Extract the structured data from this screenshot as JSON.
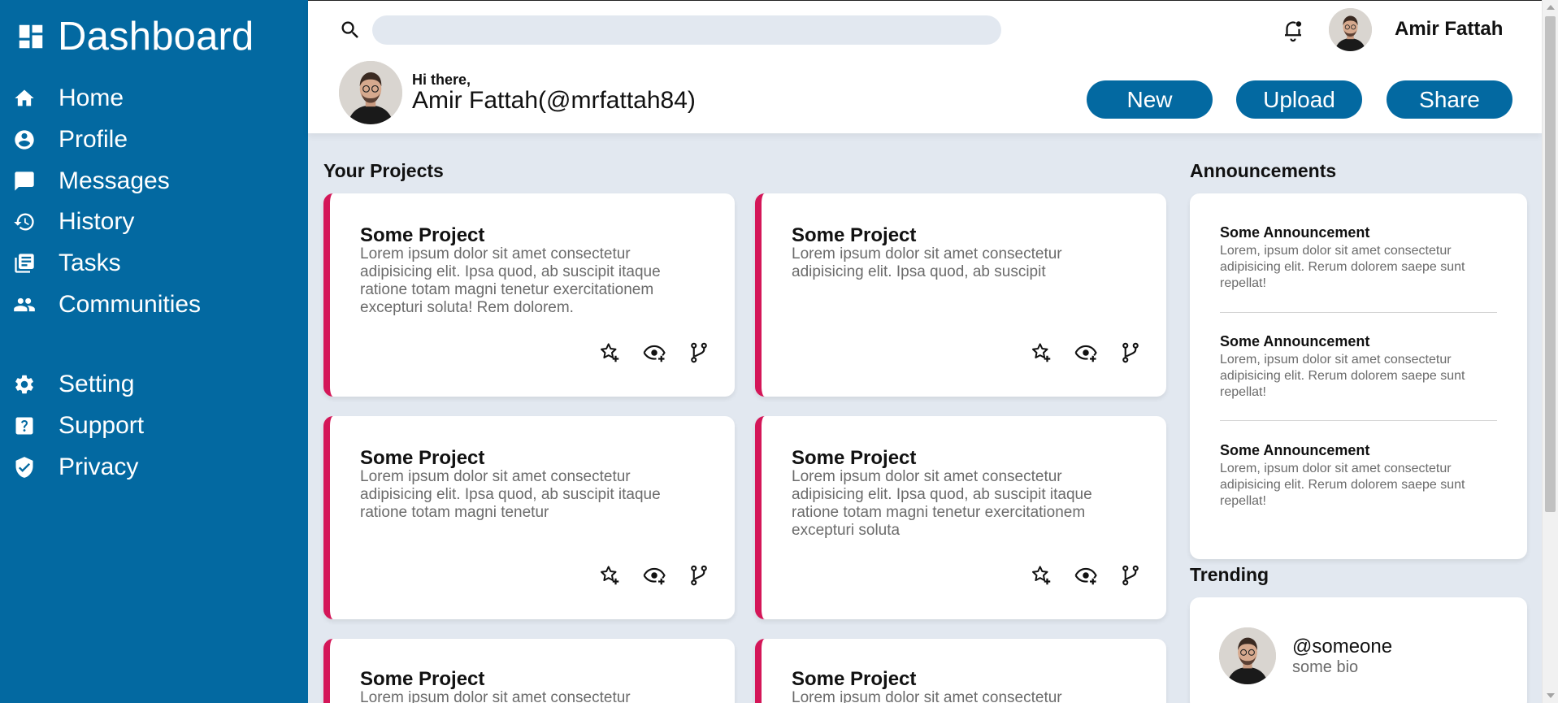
{
  "sidebar": {
    "brand": "Dashboard",
    "items": [
      {
        "label": "Home",
        "icon": "home-icon"
      },
      {
        "label": "Profile",
        "icon": "account-circle-icon"
      },
      {
        "label": "Messages",
        "icon": "message-icon"
      },
      {
        "label": "History",
        "icon": "history-icon"
      },
      {
        "label": "Tasks",
        "icon": "tasks-icon"
      },
      {
        "label": "Communities",
        "icon": "groups-icon"
      },
      {
        "label": "Setting",
        "icon": "gear-icon"
      },
      {
        "label": "Support",
        "icon": "help-icon"
      },
      {
        "label": "Privacy",
        "icon": "shield-check-icon"
      }
    ]
  },
  "header": {
    "search": {
      "placeholder": "",
      "value": ""
    },
    "user_name": "Amir Fattah",
    "greeting": "Hi there,",
    "user_handle": "Amir Fattah(@mrfattah84)",
    "buttons": {
      "new": "New",
      "upload": "Upload",
      "share": "Share"
    }
  },
  "projects": {
    "title": "Your Projects",
    "items": [
      {
        "title": "Some Project",
        "desc": "Lorem ipsum dolor sit amet consectetur adipisicing elit. Ipsa quod, ab suscipit itaque ratione totam magni tenetur exercitationem excepturi soluta! Rem dolorem."
      },
      {
        "title": "Some Project",
        "desc": "Lorem ipsum dolor sit amet consectetur adipisicing elit. Ipsa quod, ab suscipit"
      },
      {
        "title": "Some Project",
        "desc": "Lorem ipsum dolor sit amet consectetur adipisicing elit. Ipsa quod, ab suscipit itaque ratione totam magni tenetur"
      },
      {
        "title": "Some Project",
        "desc": "Lorem ipsum dolor sit amet consectetur adipisicing elit. Ipsa quod, ab suscipit itaque ratione totam magni tenetur exercitationem excepturi soluta"
      },
      {
        "title": "Some Project",
        "desc": "Lorem ipsum dolor sit amet consectetur"
      },
      {
        "title": "Some Project",
        "desc": "Lorem ipsum dolor sit amet consectetur"
      }
    ]
  },
  "announcements": {
    "title": "Announcements",
    "items": [
      {
        "title": "Some Announcement",
        "desc": "Lorem, ipsum dolor sit amet consectetur adipisicing elit. Rerum dolorem saepe sunt repellat!"
      },
      {
        "title": "Some Announcement",
        "desc": "Lorem, ipsum dolor sit amet consectetur adipisicing elit. Rerum dolorem saepe sunt repellat!"
      },
      {
        "title": "Some Announcement",
        "desc": "Lorem, ipsum dolor sit amet consectetur adipisicing elit. Rerum dolorem saepe sunt repellat!"
      }
    ]
  },
  "trending": {
    "title": "Trending",
    "items": [
      {
        "handle": "@someone",
        "bio": "some bio"
      }
    ]
  },
  "colors": {
    "primary": "#0369a1",
    "accent": "#d41658",
    "background": "#e2e8f0"
  }
}
